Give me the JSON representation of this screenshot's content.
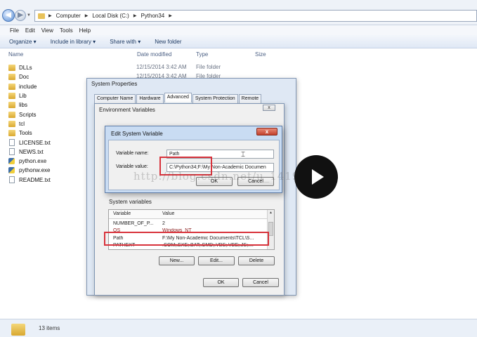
{
  "address": {
    "crumbs": [
      "Computer",
      "Local Disk (C:)",
      "Python34"
    ]
  },
  "menu": [
    "File",
    "Edit",
    "View",
    "Tools",
    "Help"
  ],
  "toolbar": {
    "organize": "Organize ▾",
    "include": "Include in library ▾",
    "share": "Share with ▾",
    "new_folder": "New folder"
  },
  "columns": {
    "name": "Name",
    "date": "Date modified",
    "type": "Type",
    "size": "Size"
  },
  "files": [
    {
      "name": "DLLs",
      "kind": "folder"
    },
    {
      "name": "Doc",
      "kind": "folder"
    },
    {
      "name": "include",
      "kind": "folder"
    },
    {
      "name": "Lib",
      "kind": "folder"
    },
    {
      "name": "libs",
      "kind": "folder"
    },
    {
      "name": "Scripts",
      "kind": "folder"
    },
    {
      "name": "tcl",
      "kind": "folder"
    },
    {
      "name": "Tools",
      "kind": "folder"
    },
    {
      "name": "LICENSE.txt",
      "kind": "doc"
    },
    {
      "name": "NEWS.txt",
      "kind": "doc"
    },
    {
      "name": "python.exe",
      "kind": "py"
    },
    {
      "name": "pythonw.exe",
      "kind": "py"
    },
    {
      "name": "README.txt",
      "kind": "doc"
    }
  ],
  "bg_rows": [
    {
      "date": "12/15/2014 3:42 AM",
      "type": "File folder"
    },
    {
      "date": "12/15/2014 3:42 AM",
      "type": "File folder"
    }
  ],
  "status": {
    "count": "13 items"
  },
  "system_properties": {
    "title": "System Properties",
    "tabs": [
      "Computer Name",
      "Hardware",
      "Advanced",
      "System Protection",
      "Remote"
    ],
    "active_tab": "Advanced",
    "ok": "OK",
    "cancel": "Cancel"
  },
  "env_vars": {
    "title": "Environment Variables",
    "close": "x",
    "system_label": "System variables",
    "headers": {
      "variable": "Variable",
      "value": "Value"
    },
    "rows": [
      {
        "variable": "NUMBER_OF_P...",
        "value": "2"
      },
      {
        "variable": "OS",
        "value": "Windows_NT"
      },
      {
        "variable": "Path",
        "value": "F:\\My Non-Academic Documents\\TCL\\S..."
      },
      {
        "variable": "PATHEXT",
        "value": ".COM;.EXE;.BAT;.CMD;.VBS;.VBE;.JS;...."
      }
    ],
    "buttons": {
      "new": "New...",
      "edit": "Edit...",
      "delete": "Delete"
    }
  },
  "edit_dialog": {
    "title": "Edit System Variable",
    "close": "x",
    "name_label": "Variable name:",
    "name_value": "Path",
    "value_label": "Variable value:",
    "value_value": "C:\\Python34;F:\\My Non-Academic Documen",
    "ok": "OK",
    "cancel": "Cancel"
  },
  "watermark": "http://blog.csdn.net/u_14192373",
  "colors": {
    "highlight": "#d8323b",
    "dialog_blue": "#c9dcf3"
  }
}
